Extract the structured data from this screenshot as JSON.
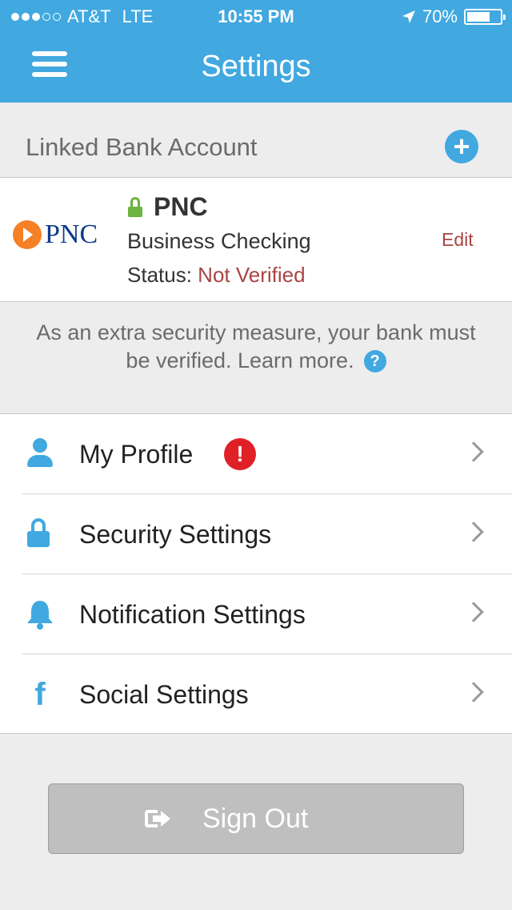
{
  "status_bar": {
    "signal_dots_filled": 3,
    "signal_dots_total": 5,
    "carrier": "AT&T",
    "network": "LTE",
    "time": "10:55 PM",
    "battery_percent": "70%",
    "battery_level": 0.7
  },
  "nav": {
    "title": "Settings",
    "menu_icon": "hamburger-menu-icon"
  },
  "bank_section": {
    "header_label": "Linked Bank Account",
    "add_icon": "plus-circle-icon"
  },
  "bank_account": {
    "logo_text": "PNC",
    "name": "PNC",
    "type": "Business Checking",
    "status_label": "Status:",
    "status_value": "Not Verified",
    "edit_label": "Edit"
  },
  "info": {
    "text": "As an extra security measure, your bank must be verified. Learn more.",
    "help_icon_glyph": "?"
  },
  "settings_list": [
    {
      "label": "My Profile",
      "icon": "user-icon",
      "alert": "!"
    },
    {
      "label": "Security Settings",
      "icon": "lock-icon"
    },
    {
      "label": "Notification Settings",
      "icon": "bell-icon"
    },
    {
      "label": "Social Settings",
      "icon": "facebook-icon",
      "icon_glyph": "f"
    }
  ],
  "sign_out": {
    "label": "Sign Out",
    "icon": "sign-out-icon"
  },
  "colors": {
    "accent": "#41a8e0",
    "error": "#a94442",
    "alert": "#e02027",
    "secure": "#6cb33f",
    "pnc_orange": "#f58025",
    "pnc_blue": "#0b3b8c"
  }
}
